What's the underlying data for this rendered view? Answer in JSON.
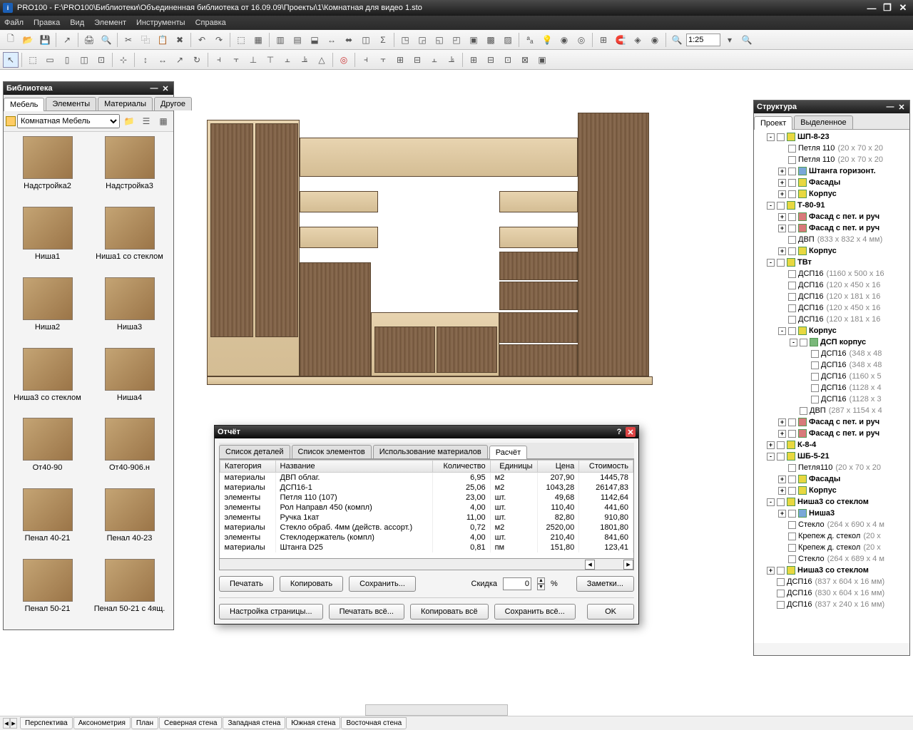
{
  "title": "PRO100 - F:\\PRO100\\Библиотеки\\Объединенная библиотека от 16.09.09\\Проекты\\1\\Комнатная для видео 1.sto",
  "menu": [
    "Файл",
    "Правка",
    "Вид",
    "Элемент",
    "Инструменты",
    "Справка"
  ],
  "zoom": "1:25",
  "library": {
    "title": "Библиотека",
    "tabs": [
      "Мебель",
      "Элементы",
      "Материалы",
      "Другое"
    ],
    "folder": "Комнатная Мебель",
    "items": [
      "Надстройка2",
      "Надстройка3",
      "Ниша1",
      "Ниша1 со стеклом",
      "Ниша2",
      "Ниша3",
      "Ниша3 со стеклом",
      "Ниша4",
      "От40-90",
      "От40-906.н",
      "Пенал 40-21",
      "Пенал 40-23",
      "Пенал 50-21",
      "Пенал 50-21 с 4ящ."
    ]
  },
  "structure": {
    "title": "Структура",
    "tabs": [
      "Проект",
      "Выделенное"
    ],
    "nodes": [
      {
        "l": 1,
        "exp": "-",
        "b": 1,
        "ic": "y",
        "t": "ШП-8-23"
      },
      {
        "l": 2,
        "t": "Петля 110",
        "d": "(20 x 70 x 20"
      },
      {
        "l": 2,
        "t": "Петля 110",
        "d": "(20 x 70 x 20"
      },
      {
        "l": 2,
        "exp": "+",
        "b": 1,
        "ic": "b",
        "t": "Штанга горизонт."
      },
      {
        "l": 2,
        "exp": "+",
        "b": 1,
        "ic": "y",
        "t": "Фасады"
      },
      {
        "l": 2,
        "exp": "+",
        "b": 1,
        "ic": "y",
        "t": "Корпус"
      },
      {
        "l": 1,
        "exp": "-",
        "b": 1,
        "ic": "y",
        "t": "Т-80-91"
      },
      {
        "l": 2,
        "exp": "+",
        "b": 1,
        "ic": "r",
        "t": "Фасад с пет. и руч"
      },
      {
        "l": 2,
        "exp": "+",
        "b": 1,
        "ic": "r",
        "t": "Фасад с пет. и руч"
      },
      {
        "l": 2,
        "t": "ДВП",
        "d": "(833 x 832 x 4 мм)"
      },
      {
        "l": 2,
        "exp": "+",
        "b": 1,
        "ic": "y",
        "t": "Корпус"
      },
      {
        "l": 1,
        "exp": "-",
        "b": 1,
        "ic": "y",
        "t": "ТВт"
      },
      {
        "l": 2,
        "t": "ДСП16",
        "d": "(1160 x 500 x 16"
      },
      {
        "l": 2,
        "t": "ДСП16",
        "d": "(120 x 450 x 16"
      },
      {
        "l": 2,
        "t": "ДСП16",
        "d": "(120 x 181 x 16"
      },
      {
        "l": 2,
        "t": "ДСП16",
        "d": "(120 x 450 x 16"
      },
      {
        "l": 2,
        "t": "ДСП16",
        "d": "(120 x 181 x 16"
      },
      {
        "l": 2,
        "exp": "-",
        "b": 1,
        "ic": "y",
        "t": "Корпус"
      },
      {
        "l": 3,
        "exp": "-",
        "b": 1,
        "ic": "g",
        "t": "ДСП корпус"
      },
      {
        "l": 4,
        "t": "ДСП16",
        "d": "(348 x 48"
      },
      {
        "l": 4,
        "t": "ДСП16",
        "d": "(348 x 48"
      },
      {
        "l": 4,
        "t": "ДСП16",
        "d": "(1160 x 5"
      },
      {
        "l": 4,
        "t": "ДСП16",
        "d": "(1128 x 4"
      },
      {
        "l": 4,
        "t": "ДСП16",
        "d": "(1128 x 3"
      },
      {
        "l": 3,
        "t": "ДВП",
        "d": "(287 x 1154 x 4"
      },
      {
        "l": 2,
        "exp": "+",
        "b": 1,
        "ic": "r",
        "t": "Фасад с пет. и руч"
      },
      {
        "l": 2,
        "exp": "+",
        "b": 1,
        "ic": "r",
        "t": "Фасад с пет. и руч"
      },
      {
        "l": 1,
        "exp": "+",
        "b": 1,
        "ic": "y",
        "t": "К-8-4"
      },
      {
        "l": 1,
        "exp": "-",
        "b": 1,
        "ic": "y",
        "t": "ШБ-5-21"
      },
      {
        "l": 2,
        "t": "Петля110",
        "d": "(20 x 70 x 20"
      },
      {
        "l": 2,
        "exp": "+",
        "b": 1,
        "ic": "y",
        "t": "Фасады"
      },
      {
        "l": 2,
        "exp": "+",
        "b": 1,
        "ic": "y",
        "t": "Корпус"
      },
      {
        "l": 1,
        "exp": "-",
        "b": 1,
        "ic": "y",
        "t": "Ниша3 со стеклом"
      },
      {
        "l": 2,
        "exp": "+",
        "b": 1,
        "ic": "b",
        "t": "Ниша3"
      },
      {
        "l": 2,
        "t": "Стекло",
        "d": "(264 x 690 x 4 м"
      },
      {
        "l": 2,
        "t": "Крепеж д. стекол",
        "d": "(20 x"
      },
      {
        "l": 2,
        "t": "Крепеж д. стекол",
        "d": "(20 x"
      },
      {
        "l": 2,
        "t": "Стекло",
        "d": "(264 x 689 x 4 м"
      },
      {
        "l": 1,
        "exp": "+",
        "b": 1,
        "ic": "y",
        "t": "Ниша3 со стеклом"
      },
      {
        "l": 1,
        "t": "ДСП16",
        "d": "(837 x 604 x 16 мм)"
      },
      {
        "l": 1,
        "t": "ДСП16",
        "d": "(830 x 604 x 16 мм)"
      },
      {
        "l": 1,
        "t": "ДСП16",
        "d": "(837 x 240 x 16 мм)"
      }
    ]
  },
  "report": {
    "title": "Отчёт",
    "tabs": [
      "Список деталей",
      "Список элементов",
      "Использование материалов",
      "Расчёт"
    ],
    "headers": [
      "Категория",
      "Название",
      "Количество",
      "Единицы",
      "Цена",
      "Стоимость"
    ],
    "rows": [
      [
        "материалы",
        "ДВП облаг.",
        "6,95",
        "м2",
        "207,90",
        "1445,78"
      ],
      [
        "материалы",
        "ДСП16-1",
        "25,06",
        "м2",
        "1043,28",
        "26147,83"
      ],
      [
        "элементы",
        "Петля 110 (107)",
        "23,00",
        "шт.",
        "49,68",
        "1142,64"
      ],
      [
        "элементы",
        "Рол Направл 450 (компл)",
        "4,00",
        "шт.",
        "110,40",
        "441,60"
      ],
      [
        "элементы",
        "Ручка 1кат",
        "11,00",
        "шт.",
        "82,80",
        "910,80"
      ],
      [
        "материалы",
        "Стекло обраб. 4мм (действ. ассорт.)",
        "0,72",
        "м2",
        "2520,00",
        "1801,80"
      ],
      [
        "элементы",
        "Стеклодержатель (компл)",
        "4,00",
        "шт.",
        "210,40",
        "841,60"
      ],
      [
        "материалы",
        "Штанга D25",
        "0,81",
        "пм",
        "151,80",
        "123,41"
      ]
    ],
    "discount_label": "Скидка",
    "discount": "0",
    "buttons": {
      "print": "Печатать",
      "copy": "Копировать",
      "save": "Сохранить...",
      "notes": "Заметки...",
      "page": "Настройка страницы...",
      "printall": "Печатать всё...",
      "copyall": "Копировать всё",
      "saveall": "Сохранить всё...",
      "ok": "OK"
    }
  },
  "statustabs": [
    "Перспектива",
    "Аксонометрия",
    "План",
    "Северная стена",
    "Западная стена",
    "Южная стена",
    "Восточная стена"
  ]
}
